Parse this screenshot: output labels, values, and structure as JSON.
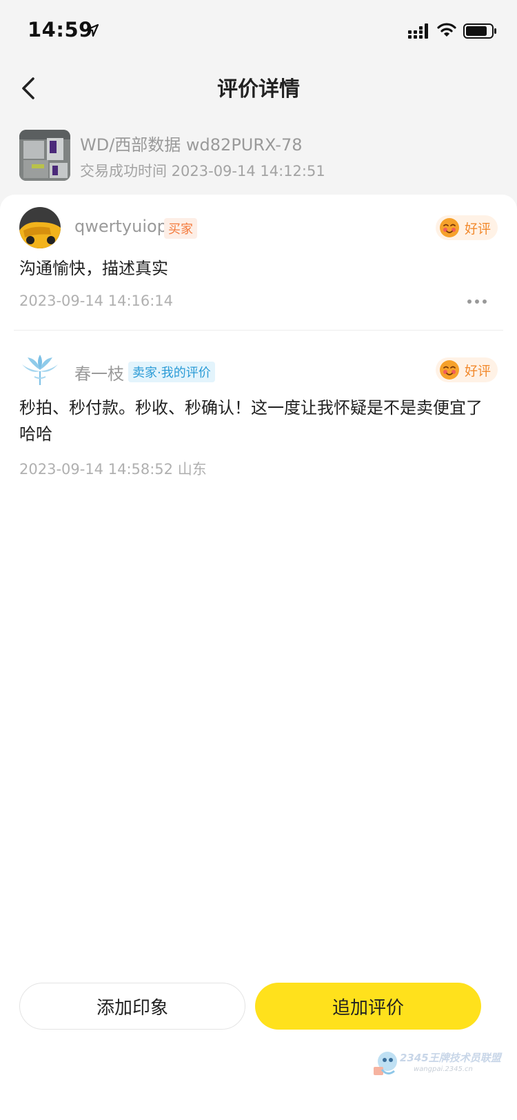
{
  "status_bar": {
    "time": "14:59"
  },
  "nav": {
    "title": "评价详情"
  },
  "product": {
    "name": "WD/西部数据 wd82PURX-78",
    "trade_time": "交易成功时间 2023-09-14 14:12:51"
  },
  "reviews": [
    {
      "username": "qwertyuiop",
      "role": "买家",
      "rating": "好评",
      "text": "沟通愉快，描述真实",
      "meta": "2023-09-14 14:16:14"
    },
    {
      "username": "春一枝",
      "role": "卖家·我的评价",
      "rating": "好评",
      "text": "秒拍、秒付款。秒收、秒确认！这一度让我怀疑是不是卖便宜了 哈哈",
      "meta": "2023-09-14 14:58:52   山东"
    }
  ],
  "actions": {
    "add_impression": "添加印象",
    "add_review": "追加评价"
  },
  "watermark": {
    "text": "2345王牌技术员联盟",
    "url": "wangpai.2345.cn"
  },
  "colors": {
    "accent": "#ffe11c",
    "buyer_badge": "#f47a3c",
    "seller_badge": "#2b9bd6",
    "rating": "#f28a2e"
  },
  "icons": {
    "location": "location-arrow-icon",
    "signal": "signal-icon",
    "wifi": "wifi-icon",
    "battery": "battery-icon",
    "back": "chevron-left-icon",
    "rating": "smile-face-icon",
    "more": "more-dots-icon"
  }
}
